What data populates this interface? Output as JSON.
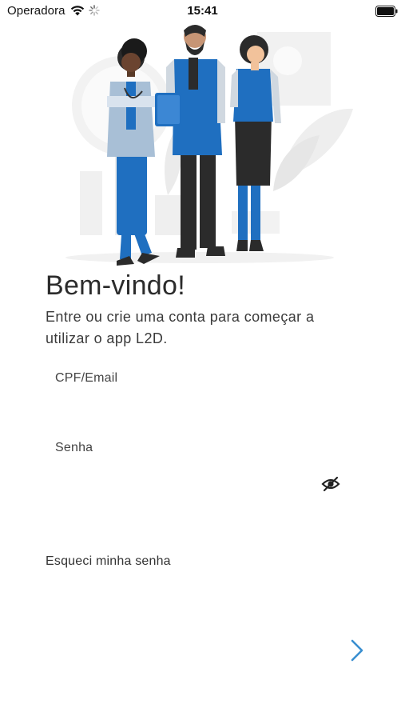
{
  "status_bar": {
    "carrier": "Operadora",
    "time": "15:41",
    "icons": [
      "wifi-icon",
      "activity-spinner-icon",
      "battery-icon"
    ]
  },
  "illustration": {
    "name": "healthcare-team-illustration",
    "colors": {
      "primary_blue": "#1f6fc0",
      "dark": "#2b2b2b",
      "light_grey": "#ececec"
    }
  },
  "welcome": {
    "title": "Bem-vindo!",
    "subtitle": "Entre ou crie uma conta para começar a utilizar o app L2D."
  },
  "form": {
    "login": {
      "label": "CPF/Email",
      "value": "",
      "placeholder": ""
    },
    "password": {
      "label": "Senha",
      "value": "",
      "placeholder": "",
      "toggle_icon": "eye-off-icon"
    },
    "forgot_password": "Esqueci minha senha",
    "next_icon": "chevron-right-icon"
  },
  "colors": {
    "accent": "#3a8fd0",
    "text": "#333333",
    "background": "#ffffff"
  }
}
